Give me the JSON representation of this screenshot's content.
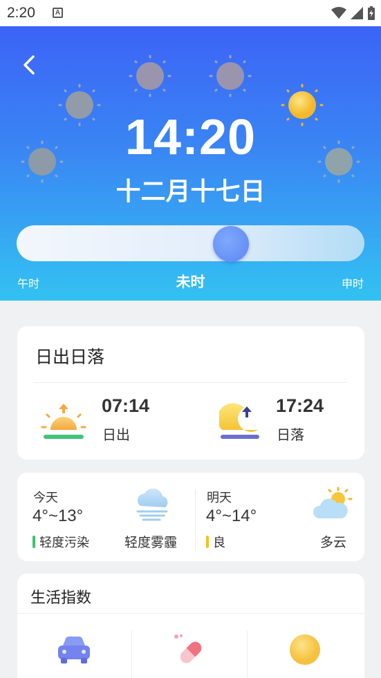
{
  "status_bar": {
    "time": "2:20",
    "notification_icon": "a-icon"
  },
  "header": {
    "time": "14:20",
    "date": "十二月十七日",
    "slider": {
      "left_label": "午时",
      "current_label": "未时",
      "right_label": "申时",
      "position_fraction": 0.6
    },
    "colors": {
      "gradient_top": "#3c63f6",
      "gradient_bottom": "#33c2f1"
    }
  },
  "sun_card": {
    "title": "日出日落",
    "sunrise": {
      "time": "07:14",
      "label": "日出",
      "icon": "sunrise-icon"
    },
    "sunset": {
      "time": "17:24",
      "label": "日落",
      "icon": "sunset-icon"
    }
  },
  "forecast": {
    "today": {
      "day": "今天",
      "temp": "4°~13°",
      "aqi": "轻度污染",
      "aqi_color": "#3cc46a",
      "condition": "轻度雾霾",
      "icon": "haze-icon"
    },
    "tomorrow": {
      "day": "明天",
      "temp": "4°~14°",
      "aqi": "良",
      "aqi_color": "#f5c21b",
      "condition": "多云",
      "icon": "partly-cloudy-icon"
    }
  },
  "life_index": {
    "title": "生活指数",
    "items": [
      {
        "icon": "car-icon"
      },
      {
        "icon": "pill-icon"
      },
      {
        "icon": "sun-icon"
      }
    ]
  }
}
